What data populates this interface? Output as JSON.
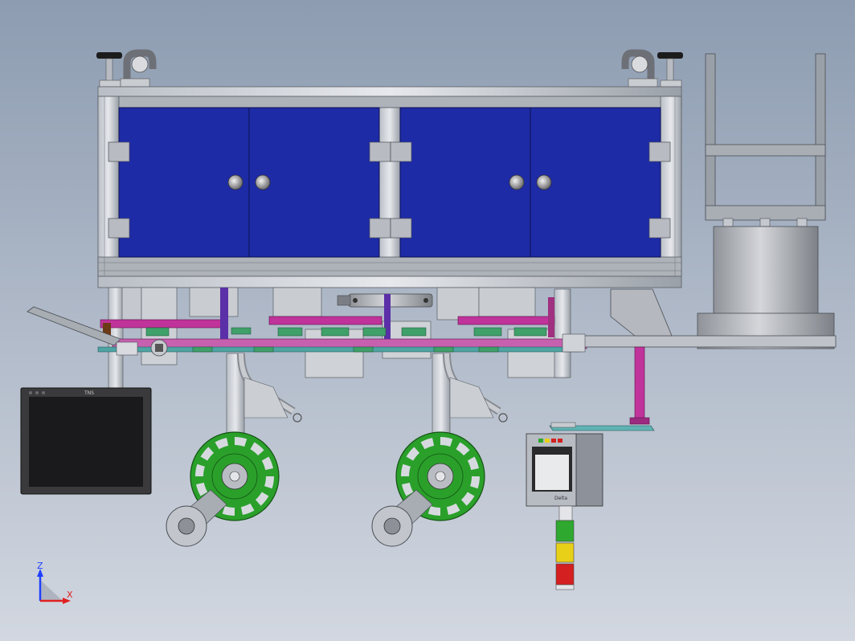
{
  "view": {
    "background_top": "#8d9cb1",
    "background_bottom": "#d2d7e0",
    "title": ""
  },
  "triad": {
    "z_label": "Z",
    "x_label": "X",
    "z_color": "#2040ff",
    "x_color": "#e02020"
  },
  "model": {
    "cabinet_panel_color": "#1e2ba6",
    "frame_color": "#9aa0a8",
    "rail_color": "#c0339b",
    "reel_color": "#2aa02a",
    "monitor_brand": "TNS",
    "hmi_brand": "Delta"
  },
  "stack_light": {
    "colors": [
      "#2ea82e",
      "#e8d018",
      "#d42020"
    ]
  }
}
